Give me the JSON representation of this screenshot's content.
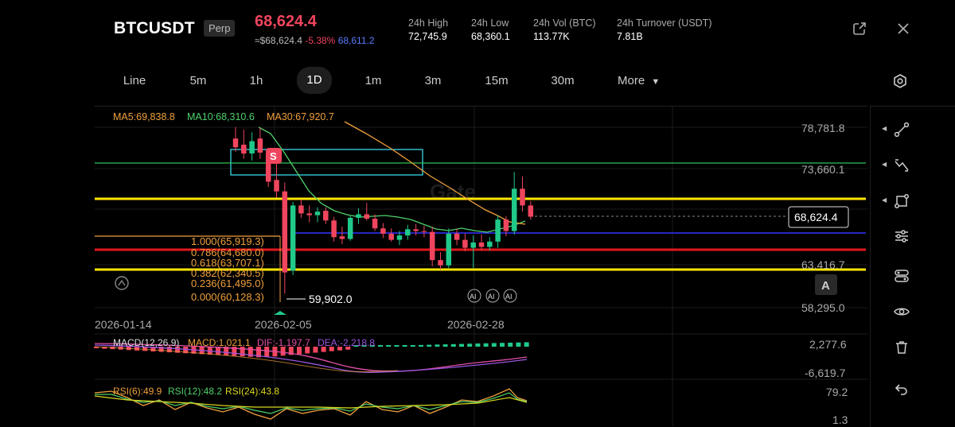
{
  "header": {
    "symbol": "BTCUSDT",
    "badge": "Perp",
    "last_price": "68,624.4",
    "usd_price": "≈$68,624.4",
    "change_pct": "-5.38%",
    "mark_price": "68,611.2",
    "stats": [
      {
        "label": "24h  High",
        "value": "72,745.9"
      },
      {
        "label": "24h  Low",
        "value": "68,360.1"
      },
      {
        "label": "24h  Vol (BTC)",
        "value": "113.77K"
      },
      {
        "label": "24h  Turnover (USDT)",
        "value": "7.81B"
      }
    ]
  },
  "timeframes": [
    "Line",
    "5m",
    "1h",
    "1D",
    "1m",
    "3m",
    "15m",
    "30m"
  ],
  "more_label": "More",
  "active_timeframe": "1D",
  "chart": {
    "ma_legend": {
      "ma5": "MA5:69,838.8",
      "ma10": "MA10:68,310.6",
      "ma30": "MA30:67,920.7"
    },
    "y_axis": [
      "78,781.8",
      "73,660.1",
      "63,416.7",
      "58,295.0"
    ],
    "price_tag": "68,624.4",
    "x_axis": [
      "2026-01-14",
      "2026-02-05",
      "2026-02-28"
    ],
    "fib_levels": [
      "1.000(65,919.3)",
      "0.786(64,680.0)",
      "0.618(63,707.1)",
      "0.382(62,340.5)",
      "0.236(61,495.0)",
      "0.000(60,128.3)"
    ],
    "low_marker": "59,902.0",
    "sell_marker": "S",
    "ai_badges": [
      "AI",
      "AI",
      "AI"
    ],
    "auto_label": "A",
    "macd_legend": {
      "name": "MACD(12,26,9)",
      "macd": "MACD:1,021.1",
      "dif": "DIF:-1,197.7",
      "dea": "DEA:-2,218.8"
    },
    "macd_axis": [
      "2,277.6",
      "-6,619.7"
    ],
    "rsi_legend": {
      "rsi6": "RSI(6):49.9",
      "rsi12": "RSI(12):48.2",
      "rsi24": "RSI(24):43.8"
    },
    "rsi_axis": [
      "79.2",
      "1.3"
    ]
  },
  "colors": {
    "up": "#20c98a",
    "down": "#f0455e",
    "accent_yellow": "#ffe600",
    "ma5": "#f0a03c",
    "ma10": "#4fd06a"
  },
  "icons": [
    "share-icon",
    "close-icon",
    "settings-icon",
    "line-tool-icon",
    "trend-tool-icon",
    "shape-tool-icon",
    "indicator-icon",
    "layers-icon",
    "eye-icon",
    "trash-icon",
    "undo-icon"
  ],
  "chart_data": {
    "type": "candlestick",
    "y_range": [
      58295.0,
      78781.8
    ],
    "candles": [
      {
        "o": 77500,
        "h": 78800,
        "l": 76000,
        "c": 76500
      },
      {
        "o": 76800,
        "h": 78500,
        "l": 75200,
        "c": 75800
      },
      {
        "o": 75800,
        "h": 78200,
        "l": 75000,
        "c": 77200
      },
      {
        "o": 77500,
        "h": 78700,
        "l": 75200,
        "c": 75900
      },
      {
        "o": 75800,
        "h": 76400,
        "l": 72000,
        "c": 72600
      },
      {
        "o": 72800,
        "h": 74900,
        "l": 70800,
        "c": 71500
      },
      {
        "o": 71500,
        "h": 72500,
        "l": 59902,
        "c": 62300
      },
      {
        "o": 62500,
        "h": 70300,
        "l": 62000,
        "c": 69900
      },
      {
        "o": 69900,
        "h": 70600,
        "l": 68500,
        "c": 69000
      },
      {
        "o": 69000,
        "h": 69900,
        "l": 68000,
        "c": 68800
      },
      {
        "o": 68800,
        "h": 69700,
        "l": 68000,
        "c": 69200
      },
      {
        "o": 69300,
        "h": 69700,
        "l": 67800,
        "c": 68200
      },
      {
        "o": 68200,
        "h": 68600,
        "l": 65800,
        "c": 66300
      },
      {
        "o": 66400,
        "h": 67500,
        "l": 65500,
        "c": 66100
      },
      {
        "o": 66100,
        "h": 68700,
        "l": 65900,
        "c": 68500
      },
      {
        "o": 68500,
        "h": 69600,
        "l": 67800,
        "c": 68900
      },
      {
        "o": 68900,
        "h": 70200,
        "l": 68200,
        "c": 68400
      },
      {
        "o": 68400,
        "h": 68900,
        "l": 67000,
        "c": 67300
      },
      {
        "o": 67300,
        "h": 67900,
        "l": 66200,
        "c": 66700
      },
      {
        "o": 66700,
        "h": 67300,
        "l": 65800,
        "c": 66000
      },
      {
        "o": 66000,
        "h": 67000,
        "l": 65400,
        "c": 66500
      },
      {
        "o": 66500,
        "h": 67700,
        "l": 66000,
        "c": 67200
      },
      {
        "o": 67200,
        "h": 67800,
        "l": 66500,
        "c": 67000
      },
      {
        "o": 67000,
        "h": 67600,
        "l": 66300,
        "c": 66900
      },
      {
        "o": 66900,
        "h": 67500,
        "l": 63000,
        "c": 63700
      },
      {
        "o": 63700,
        "h": 64600,
        "l": 62600,
        "c": 63100
      },
      {
        "o": 63100,
        "h": 67300,
        "l": 62800,
        "c": 66700
      },
      {
        "o": 66700,
        "h": 67300,
        "l": 65400,
        "c": 66000
      },
      {
        "o": 66000,
        "h": 66700,
        "l": 64700,
        "c": 65100
      },
      {
        "o": 65100,
        "h": 66500,
        "l": 62800,
        "c": 65700
      },
      {
        "o": 65700,
        "h": 66600,
        "l": 64800,
        "c": 65200
      },
      {
        "o": 65200,
        "h": 66300,
        "l": 64800,
        "c": 65800
      },
      {
        "o": 65800,
        "h": 68800,
        "l": 65100,
        "c": 68300
      },
      {
        "o": 68300,
        "h": 68700,
        "l": 66400,
        "c": 67000
      },
      {
        "o": 67000,
        "h": 73700,
        "l": 66600,
        "c": 71800
      },
      {
        "o": 71800,
        "h": 73200,
        "l": 69200,
        "c": 69900
      },
      {
        "o": 69900,
        "h": 70400,
        "l": 68300,
        "c": 68624.4
      }
    ]
  }
}
